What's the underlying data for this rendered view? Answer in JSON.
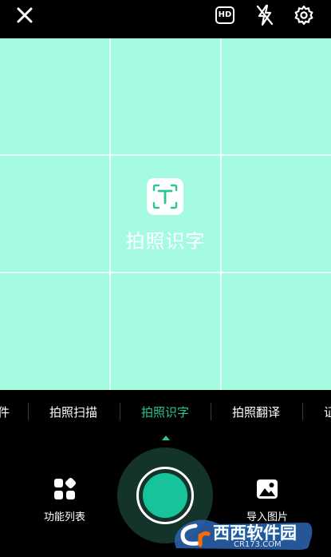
{
  "topbar": {
    "close_icon": "close-icon",
    "hd_label": "HD",
    "flash_icon": "flash-off-icon",
    "settings_icon": "gear-icon"
  },
  "viewfinder": {
    "background": "#a5fbe1",
    "mode_icon": "text-recognition-icon",
    "mode_title": "拍照识字"
  },
  "tabs": {
    "items": [
      {
        "label": "件",
        "active": false
      },
      {
        "label": "拍照扫描",
        "active": false
      },
      {
        "label": "拍照识字",
        "active": true
      },
      {
        "label": "拍照翻译",
        "active": false
      },
      {
        "label": "证",
        "active": false
      }
    ],
    "accent": "#2cc49a"
  },
  "bottom": {
    "function_list_label": "功能列表",
    "function_list_icon": "grid-apps-icon",
    "import_image_label": "导入图片",
    "import_image_icon": "image-icon",
    "shutter_color": "#16c39b"
  },
  "watermark": {
    "text": "西西软件园",
    "sub": "CR173.COM"
  }
}
